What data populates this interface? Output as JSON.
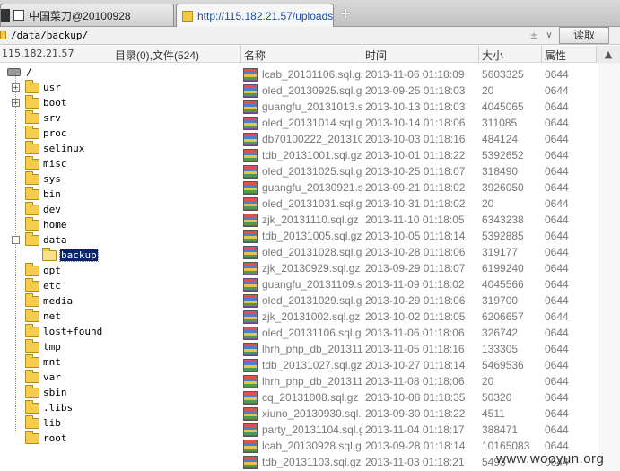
{
  "tabs": [
    {
      "label": "中国菜刀@20100928",
      "icon": "document-icon",
      "active": false
    },
    {
      "label": "http://115.182.21.57/uploads...",
      "icon": "folder-icon",
      "active": true
    }
  ],
  "new_tab_label": "+",
  "path": {
    "value": "/data/backup/",
    "stepper": "±",
    "dropdown": "∨",
    "read_button": "读取"
  },
  "header": {
    "host": "115.182.21.57",
    "counts": "目录(0),文件(524)",
    "col_name": "名称",
    "col_time": "时间",
    "col_size": "大小",
    "col_attr": "属性",
    "scroll_arrow": "▲"
  },
  "tree": [
    {
      "label": "/",
      "level": 0,
      "expander": "",
      "type": "drive"
    },
    {
      "label": "usr",
      "level": 1,
      "expander": "+"
    },
    {
      "label": "boot",
      "level": 1,
      "expander": "+"
    },
    {
      "label": "srv",
      "level": 1,
      "expander": ""
    },
    {
      "label": "proc",
      "level": 1,
      "expander": ""
    },
    {
      "label": "selinux",
      "level": 1,
      "expander": ""
    },
    {
      "label": "misc",
      "level": 1,
      "expander": ""
    },
    {
      "label": "sys",
      "level": 1,
      "expander": ""
    },
    {
      "label": "bin",
      "level": 1,
      "expander": ""
    },
    {
      "label": "dev",
      "level": 1,
      "expander": ""
    },
    {
      "label": "home",
      "level": 1,
      "expander": ""
    },
    {
      "label": "data",
      "level": 1,
      "expander": "−"
    },
    {
      "label": "backup",
      "level": 2,
      "expander": "",
      "selected": true,
      "open": true
    },
    {
      "label": "opt",
      "level": 1,
      "expander": ""
    },
    {
      "label": "etc",
      "level": 1,
      "expander": ""
    },
    {
      "label": "media",
      "level": 1,
      "expander": ""
    },
    {
      "label": "net",
      "level": 1,
      "expander": ""
    },
    {
      "label": "lost+found",
      "level": 1,
      "expander": ""
    },
    {
      "label": "tmp",
      "level": 1,
      "expander": ""
    },
    {
      "label": "mnt",
      "level": 1,
      "expander": ""
    },
    {
      "label": "var",
      "level": 1,
      "expander": ""
    },
    {
      "label": "sbin",
      "level": 1,
      "expander": ""
    },
    {
      "label": ".libs",
      "level": 1,
      "expander": ""
    },
    {
      "label": "lib",
      "level": 1,
      "expander": ""
    },
    {
      "label": "root",
      "level": 1,
      "expander": ""
    }
  ],
  "files": [
    {
      "name": "lcab_20131106.sql.gz",
      "time": "2013-11-06 01:18:09",
      "size": "5603325",
      "attr": "0644"
    },
    {
      "name": "oled_20130925.sql.gz",
      "time": "2013-09-25 01:18:03",
      "size": "20",
      "attr": "0644"
    },
    {
      "name": "guangfu_20131013.s...",
      "time": "2013-10-13 01:18:03",
      "size": "4045065",
      "attr": "0644"
    },
    {
      "name": "oled_20131014.sql.gz",
      "time": "2013-10-14 01:18:06",
      "size": "311085",
      "attr": "0644"
    },
    {
      "name": "db70100222_201310...",
      "time": "2013-10-03 01:18:16",
      "size": "484124",
      "attr": "0644"
    },
    {
      "name": "tdb_20131001.sql.gz",
      "time": "2013-10-01 01:18:22",
      "size": "5392652",
      "attr": "0644"
    },
    {
      "name": "oled_20131025.sql.gz",
      "time": "2013-10-25 01:18:07",
      "size": "318490",
      "attr": "0644"
    },
    {
      "name": "guangfu_20130921.s...",
      "time": "2013-09-21 01:18:02",
      "size": "3926050",
      "attr": "0644"
    },
    {
      "name": "oled_20131031.sql.gz",
      "time": "2013-10-31 01:18:02",
      "size": "20",
      "attr": "0644"
    },
    {
      "name": "zjk_20131110.sql.gz",
      "time": "2013-11-10 01:18:05",
      "size": "6343238",
      "attr": "0644"
    },
    {
      "name": "tdb_20131005.sql.gz",
      "time": "2013-10-05 01:18:14",
      "size": "5392885",
      "attr": "0644"
    },
    {
      "name": "oled_20131028.sql.gz",
      "time": "2013-10-28 01:18:06",
      "size": "319177",
      "attr": "0644"
    },
    {
      "name": "zjk_20130929.sql.gz",
      "time": "2013-09-29 01:18:07",
      "size": "6199240",
      "attr": "0644"
    },
    {
      "name": "guangfu_20131109.s...",
      "time": "2013-11-09 01:18:02",
      "size": "4045566",
      "attr": "0644"
    },
    {
      "name": "oled_20131029.sql.gz",
      "time": "2013-10-29 01:18:06",
      "size": "319700",
      "attr": "0644"
    },
    {
      "name": "zjk_20131002.sql.gz",
      "time": "2013-10-02 01:18:05",
      "size": "6206657",
      "attr": "0644"
    },
    {
      "name": "oled_20131106.sql.gz",
      "time": "2013-11-06 01:18:06",
      "size": "326742",
      "attr": "0644"
    },
    {
      "name": "lhrh_php_db_201311...",
      "time": "2013-11-05 01:18:16",
      "size": "133305",
      "attr": "0644"
    },
    {
      "name": "tdb_20131027.sql.gz",
      "time": "2013-10-27 01:18:14",
      "size": "5469536",
      "attr": "0644"
    },
    {
      "name": "lhrh_php_db_201311...",
      "time": "2013-11-08 01:18:06",
      "size": "20",
      "attr": "0644"
    },
    {
      "name": "cq_20131008.sql.gz",
      "time": "2013-10-08 01:18:35",
      "size": "50320",
      "attr": "0644"
    },
    {
      "name": "xiuno_20130930.sql.gz",
      "time": "2013-09-30 01:18:22",
      "size": "4511",
      "attr": "0644"
    },
    {
      "name": "party_20131104.sql.gz",
      "time": "2013-11-04 01:18:17",
      "size": "388471",
      "attr": "0644"
    },
    {
      "name": "lcab_20130928.sql.gz",
      "time": "2013-09-28 01:18:14",
      "size": "10165083",
      "attr": "0644"
    },
    {
      "name": "tdb_20131103.sql.gz",
      "time": "2013-11-03 01:18:21",
      "size": "5493",
      "attr": "0644"
    }
  ],
  "watermark": "www.wooyun.org"
}
